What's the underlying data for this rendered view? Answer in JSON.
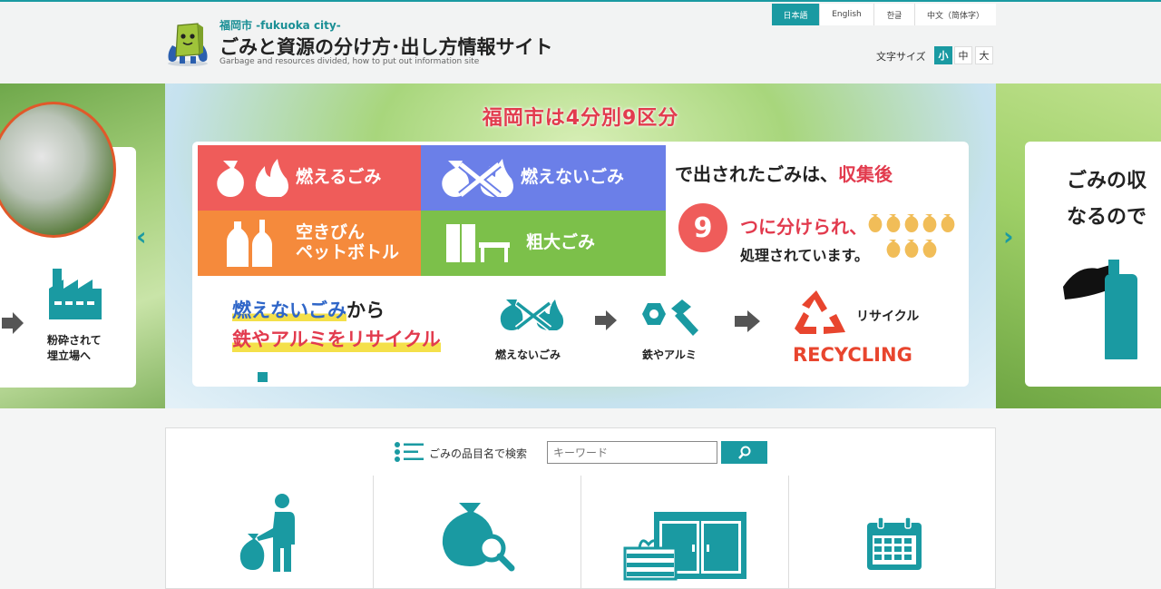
{
  "header": {
    "city": "福岡市 -fukuoka city-",
    "title": "ごみと資源の分け方･出し方情報サイト",
    "subtitle": "Garbage and resources divided, how to put out information site"
  },
  "languages": [
    "日本語",
    "English",
    "한글",
    "中文（简体字）"
  ],
  "font_size": {
    "label": "文字サイズ",
    "options": [
      "小",
      "中",
      "大"
    ],
    "selected": "小"
  },
  "slider": {
    "title": "福岡市は4分別9区分",
    "tiles": {
      "burnable": "燃えるごみ",
      "non_burnable": "燃えないごみ",
      "bottles_1": "空きびん",
      "bottles_2": "ペットボトル",
      "oversized": "粗大ごみ"
    },
    "collected_text_a": "で出されたごみは、",
    "collected_text_b": "収集後",
    "nine": "9",
    "divided_text": "つに分けられ、",
    "processed_text": "処理されています。",
    "recycle_line1_a": "燃えないごみ",
    "recycle_line1_b": "から",
    "recycle_line2": "鉄やアルミをリサイクル",
    "step_nonburnable": "燃えないごみ",
    "step_metal": "鉄やアルミ",
    "step_recycle": "リサイクル",
    "recycling_word": "RECYCLING",
    "left_caption_1": "粉砕されて",
    "left_caption_2": "埋立場へ",
    "right_caption_1": "ごみの収",
    "right_caption_2": "なるので"
  },
  "search": {
    "label": "ごみの品目名で検索",
    "placeholder": "キーワード"
  },
  "colors": {
    "accent": "#1a9aa2",
    "burnable": "#ef5c5a",
    "non_burnable": "#6b7fe8",
    "bottles": "#f58a3c",
    "oversized": "#7cc04a",
    "title_red": "#e23b4e"
  }
}
